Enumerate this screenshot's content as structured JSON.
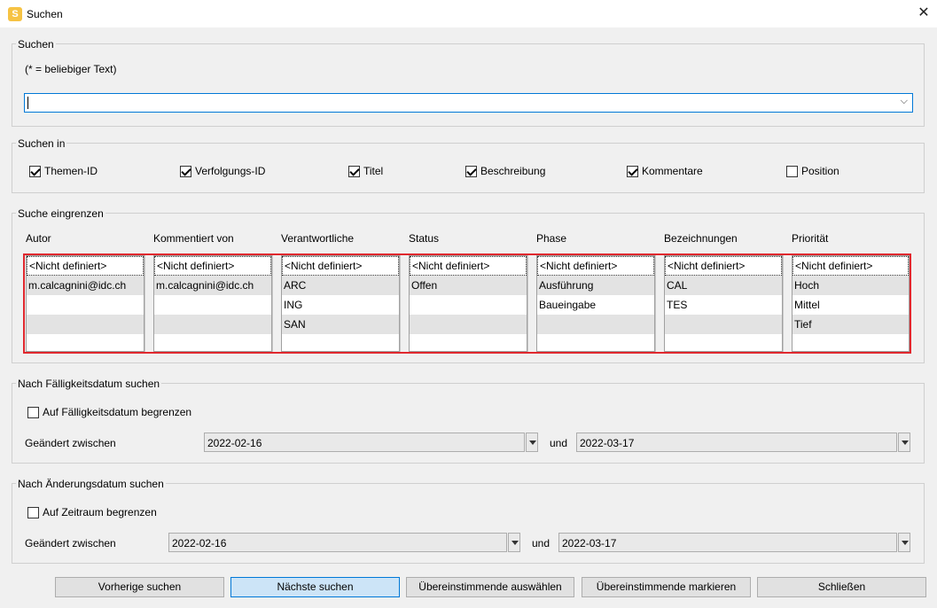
{
  "window": {
    "title": "Suchen",
    "app_icon": "S"
  },
  "search": {
    "legend": "Suchen",
    "hint": "(* = beliebiger Text)",
    "value": ""
  },
  "search_in": {
    "legend": "Suchen in",
    "options": [
      {
        "label": "Themen-ID",
        "checked": true
      },
      {
        "label": "Verfolgungs-ID",
        "checked": true
      },
      {
        "label": "Titel",
        "checked": true
      },
      {
        "label": "Beschreibung",
        "checked": true
      },
      {
        "label": "Kommentare",
        "checked": true
      },
      {
        "label": "Position",
        "checked": false
      }
    ]
  },
  "narrow": {
    "legend": "Suche eingrenzen",
    "columns": [
      {
        "header": "Autor",
        "items": [
          "<Nicht definiert>",
          "m.calcagnini@idc.ch"
        ]
      },
      {
        "header": "Kommentiert von",
        "items": [
          "<Nicht definiert>",
          "m.calcagnini@idc.ch"
        ]
      },
      {
        "header": "Verantwortliche",
        "items": [
          "<Nicht definiert>",
          "ARC",
          "ING",
          "SAN"
        ]
      },
      {
        "header": "Status",
        "items": [
          "<Nicht definiert>",
          "Offen"
        ]
      },
      {
        "header": "Phase",
        "items": [
          "<Nicht definiert>",
          "Ausführung",
          "Baueingabe"
        ]
      },
      {
        "header": "Bezeichnungen",
        "items": [
          "<Nicht definiert>",
          "CAL",
          "TES"
        ]
      },
      {
        "header": "Priorität",
        "items": [
          "<Nicht definiert>",
          "Hoch",
          "Mittel",
          "Tief"
        ]
      }
    ]
  },
  "due_date": {
    "legend": "Nach Fälligkeitsdatum suchen",
    "limit_label": "Auf Fälligkeitsdatum begrenzen",
    "limit_checked": false,
    "range_label": "Geändert zwischen",
    "from": "2022-02-16",
    "and_label": "und",
    "to": "2022-03-17"
  },
  "change_date": {
    "legend": "Nach Änderungsdatum suchen",
    "limit_label": "Auf Zeitraum begrenzen",
    "limit_checked": false,
    "range_label": "Geändert zwischen",
    "from": "2022-02-16",
    "and_label": "und",
    "to": "2022-03-17"
  },
  "buttons": {
    "previous": "Vorherige suchen",
    "next": "Nächste suchen",
    "select_matching": "Übereinstimmende auswählen",
    "mark_matching": "Übereinstimmende markieren",
    "close": "Schließen"
  },
  "colors": {
    "accent": "#0078d7",
    "highlight_frame": "#e0282e",
    "primary_button": "#cce4f7"
  }
}
